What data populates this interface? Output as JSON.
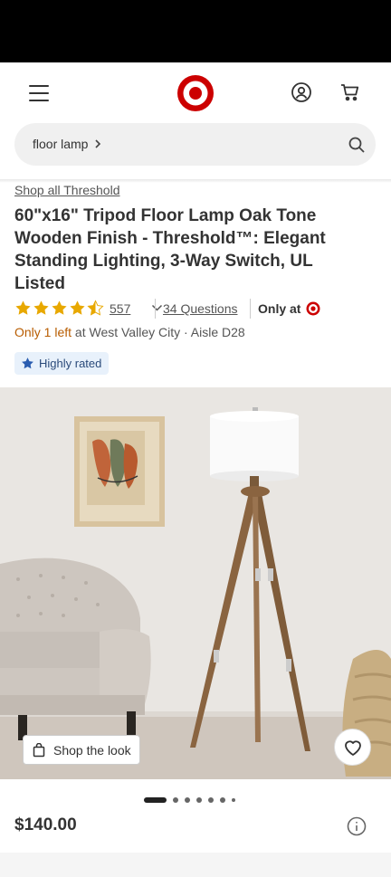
{
  "header": {
    "logo": "target-logo",
    "icons": [
      "hamburger-menu-icon",
      "account-icon",
      "cart-icon"
    ]
  },
  "search": {
    "term": "floor lamp",
    "icon": "search-icon"
  },
  "product": {
    "brand_link": "Shop all Threshold",
    "title": "60\"x16\" Tripod Floor Lamp Oak Tone Wooden Finish - Threshold™: Elegant Standing Lighting, 3-Way Switch, UL Listed",
    "rating": 4.5,
    "rating_max": 5,
    "review_count": "557",
    "questions": "34 Questions",
    "only_at": "Only at",
    "stock_warning": "Only 1 left",
    "stock_location": " at West Valley City · Aisle D28",
    "badge": "Highly rated",
    "shop_the_look": "Shop the look",
    "price": "$140.00",
    "image_count": 7,
    "active_image": 0
  },
  "colors": {
    "target_red": "#cc0000",
    "star_gold": "#e8a800",
    "stock_orange": "#b85c00",
    "badge_blue": "#2a5db0",
    "badge_bg": "#e8f1fb"
  }
}
